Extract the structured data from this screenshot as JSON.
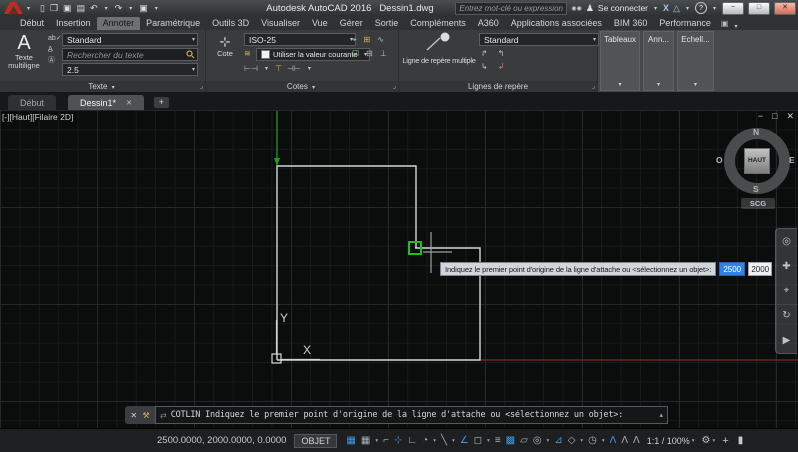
{
  "titlebar": {
    "app_title": "Autodesk AutoCAD 2016",
    "doc_title": "Dessin1.dwg",
    "search_placeholder": "Entrez mot-clé ou expression",
    "signin_label": "Se connecter"
  },
  "glyphs": {
    "caret": "▾",
    "launcher": "⌟",
    "close": "✕",
    "minus": "−",
    "restore": "□",
    "up": "▴",
    "help": "?",
    "exchange_x": "X",
    "appstore_a": "△",
    "person": "♟",
    "binoculars": "◉◉",
    "swap": "⇄",
    "wrench": "⚒",
    "plus": "+",
    "wheel": "◎",
    "pan": "✚",
    "zoom_glass": "⌖",
    "orbit": "↻",
    "play": "▶"
  },
  "qat": {
    "icons": [
      "▯",
      "❒",
      "▣",
      "▤",
      "↶",
      "↷",
      "▣"
    ]
  },
  "ribbon_tabs": [
    "Début",
    "Insertion",
    "Annoter",
    "Paramétrique",
    "Outils 3D",
    "Visualiser",
    "Vue",
    "Gérer",
    "Sortie",
    "Compléments",
    "A360",
    "Applications associées",
    "BIM 360",
    "Performance"
  ],
  "ribbon": {
    "texte": {
      "big_glyph": "A",
      "big_label": "Texte\nmultiligne",
      "spell_icon": "ab✓",
      "find_icon": "A̲",
      "style_icon": "Ⓐ",
      "style_value": "Standard",
      "search_placeholder": "Rechercher du texte",
      "height_value": "2.5",
      "footer": "Texte"
    },
    "cotes": {
      "button_icon": "⊹",
      "button_label": "Cote",
      "style_value": "ISO-25",
      "layer_icon": "≋",
      "current_value": "Utiliser la valeur courante",
      "row_icons": [
        "⊢⊣",
        "⊤",
        "⊣⊢"
      ],
      "grid_icons": [
        "⌖",
        "⊞",
        "∿",
        "☑",
        "⊟",
        "⊥"
      ],
      "footer": "Cotes"
    },
    "reperes": {
      "button_label": "Ligne de repère multiple",
      "style_value": "Standard",
      "grid_icons": [
        "↱",
        "↰",
        "↳",
        "↲"
      ],
      "footer": "Lignes de repère"
    },
    "collapsed_panels": [
      "Tableaux",
      "Ann...",
      "Echell..."
    ]
  },
  "file_tabs": {
    "start": "Début",
    "active": "Dessin1*"
  },
  "canvas": {
    "viewport_label": "[-][Haut][Filaire 2D]",
    "cube_face": "HAUT",
    "north": "N",
    "south": "S",
    "east": "E",
    "west": "O",
    "ucs_button": "SCG",
    "axis_x": "X",
    "axis_y": "Y"
  },
  "tooltip": {
    "text": "Indiquez le premier point d'origine de la ligne d'attache ou <sélectionnez un objet>:",
    "x_value": "2500",
    "y_value": "2000"
  },
  "command_line": {
    "text": "COTLIN Indiquez le premier point d'origine de la ligne d'attache ou <sélectionnez un objet>:"
  },
  "statusbar": {
    "coords": "2500.0000, 2000.0000, 0.0000",
    "mode": "OBJET",
    "scale": "1:1 / 100%",
    "icons": [
      {
        "name": "snap-mode",
        "g": "▦"
      },
      {
        "name": "grid-display",
        "g": "▦"
      },
      {
        "name": "infer-constraints",
        "g": "⌐"
      },
      {
        "name": "dynamic-input",
        "g": "⊹"
      },
      {
        "name": "ortho-mode",
        "g": "∟"
      },
      {
        "name": "polar-tracking",
        "g": "◔"
      },
      {
        "name": "isometric-drafting",
        "g": "╲"
      },
      {
        "name": "osnap-tracking",
        "g": "∠"
      },
      {
        "name": "object-snap",
        "g": "◻"
      },
      {
        "name": "lineweight",
        "g": "≡"
      },
      {
        "name": "transparency",
        "g": "▩"
      },
      {
        "name": "selection-cycling",
        "g": "▱"
      },
      {
        "name": "threed-osnap",
        "g": "◎"
      },
      {
        "name": "dynamic-ucs",
        "g": "⊿"
      },
      {
        "name": "selection-filter",
        "g": "◇"
      },
      {
        "name": "gizmo",
        "g": "◷"
      },
      {
        "name": "annotation-visibility",
        "g": "Λ"
      },
      {
        "name": "annotation-autoscale",
        "g": "Λ"
      },
      {
        "name": "annotation-scale",
        "g": "Λ"
      }
    ]
  },
  "colors": {
    "accent_blue": "#3d9be9",
    "marker_green": "#19c119",
    "geometry_line": "#d6d6d6",
    "axis_red": "#7b2a35",
    "logo_red": "#bf2b20"
  }
}
